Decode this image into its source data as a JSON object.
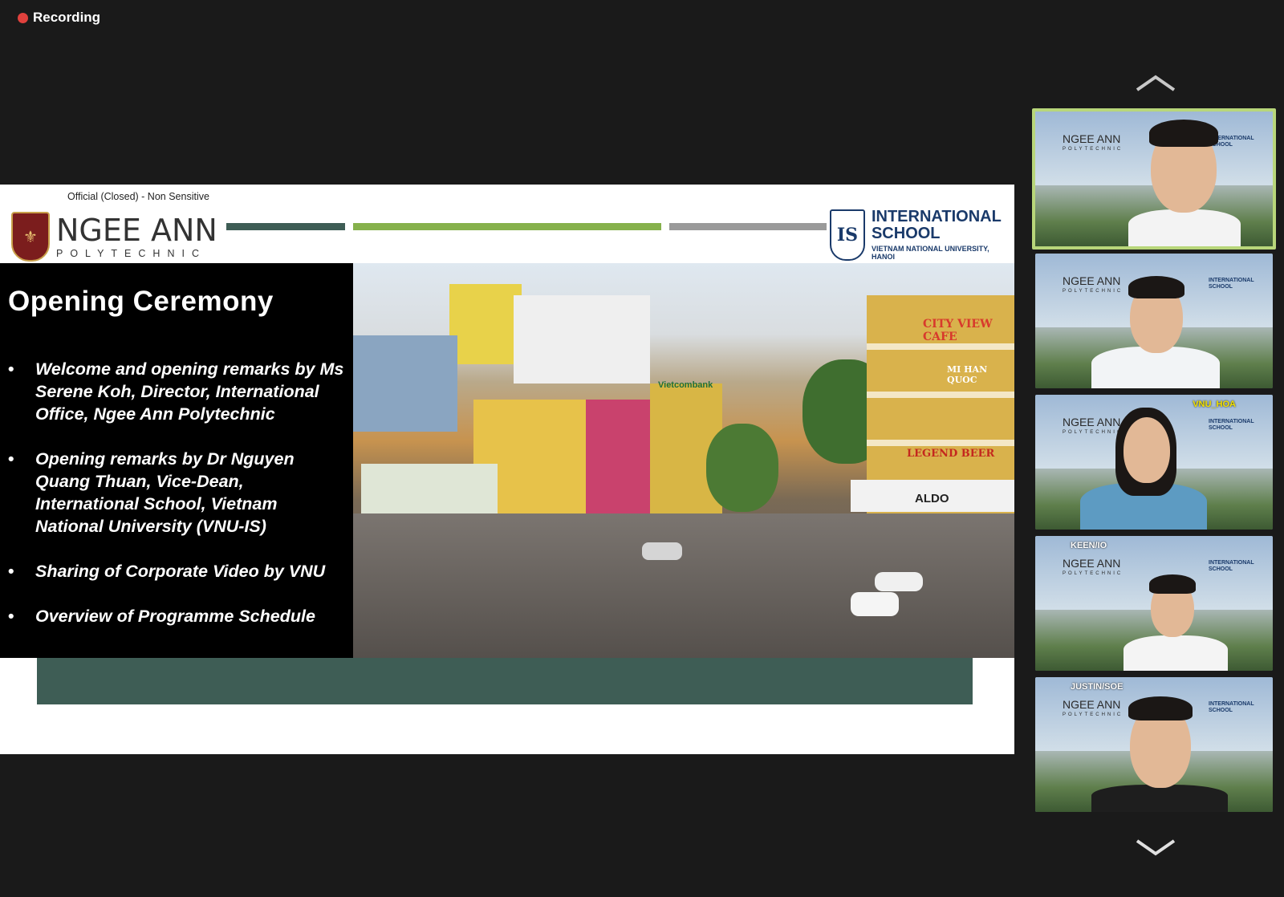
{
  "recording": {
    "label": "Recording",
    "dot_color": "#e0413d"
  },
  "slide": {
    "classification": "Official (Closed) - Non Sensitive",
    "left_logo": {
      "main": "NGEE ANN",
      "sub": "POLYTECHNIC",
      "crest_glyph": "⚜"
    },
    "right_logo": {
      "monogram": "IS",
      "line1": "INTERNATIONAL",
      "line2": "SCHOOL",
      "line3": "VIETNAM NATIONAL UNIVERSITY, HANOI"
    },
    "title": "Opening Ceremony",
    "agenda": [
      "Welcome and opening remarks by Ms Serene Koh, Director, International Office, Ngee Ann Polytechnic",
      "Opening remarks by Dr Nguyen Quang Thuan, Vice-Dean, International School, Vietnam National University (VNU-IS)",
      "Sharing of Corporate Video by VNU",
      "Overview of Programme Schedule"
    ],
    "photo_signs": {
      "top": "CITY VIEW CAFE",
      "bank": "Vietcombank",
      "restaurant": "MI HAN QUOC",
      "beer": "LEGEND BEER",
      "store": "ALDO"
    },
    "colors": {
      "dark_green": "#3e5d55",
      "light_green": "#86b14c",
      "grey": "#9a9a9a"
    }
  },
  "gallery": {
    "up_icon": "chevron-up-icon",
    "down_icon": "chevron-down-icon",
    "tiles": [
      {
        "name": "",
        "active": true
      },
      {
        "name": "",
        "active": false
      },
      {
        "name": "VNU_HOA",
        "active": false
      },
      {
        "name": "KEEN/IO",
        "active": false
      },
      {
        "name": "JUSTIN/SOE",
        "active": false
      }
    ],
    "tile_logo_main": "NGEE ANN",
    "tile_logo_sub": "POLYTECHNIC",
    "tile_is_text": "INTERNATIONAL SCHOOL",
    "active_border_color": "#b8d67a"
  }
}
